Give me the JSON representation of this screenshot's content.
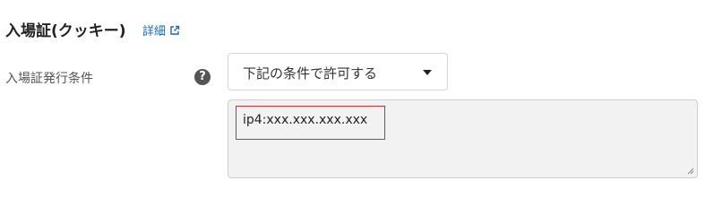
{
  "section": {
    "title": "入場証(クッキー)",
    "detail_link_label": "詳細"
  },
  "field": {
    "label": "入場証発行条件",
    "help_glyph": "?",
    "select": {
      "selected": "下記の条件で許可する"
    },
    "textarea": {
      "value": "ip4:xxx.xxx.xxx.xxx"
    }
  },
  "colors": {
    "link": "#1a6bb8",
    "highlight_border": "#c0392b",
    "textarea_bg": "#f2f2f2",
    "help_icon_bg": "#555555"
  },
  "icons": {
    "detail_link": "external-link-icon",
    "help": "question-circle-icon",
    "select": "caret-down-icon",
    "textarea": "resize-handle-icon"
  }
}
